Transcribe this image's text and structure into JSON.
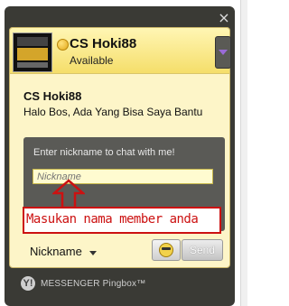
{
  "widget": {
    "agent_name": "CS Hoki88",
    "status": "Available",
    "close_symbol": "×"
  },
  "greeting": {
    "name": "CS Hoki88",
    "message": "Halo Bos, Ada Yang Bisa Saya Bantu"
  },
  "nickname_form": {
    "prompt": "Enter nickname to chat with me!",
    "placeholder": "Nickname"
  },
  "annotation": {
    "text": "Masukan nama member anda",
    "color": "#cc1111"
  },
  "controls": {
    "nickname_label": "Nickname",
    "send_label": "Send"
  },
  "footer": {
    "y_icon": "Y!",
    "text": "MESSENGER Pingbox™"
  },
  "colors": {
    "frame": "#3a3a35",
    "panel": "#fdf5c8",
    "header_gradient_top": "#fff6b4",
    "header_gradient_bottom": "#f5de6a",
    "status_dot": "#e3a91a"
  }
}
